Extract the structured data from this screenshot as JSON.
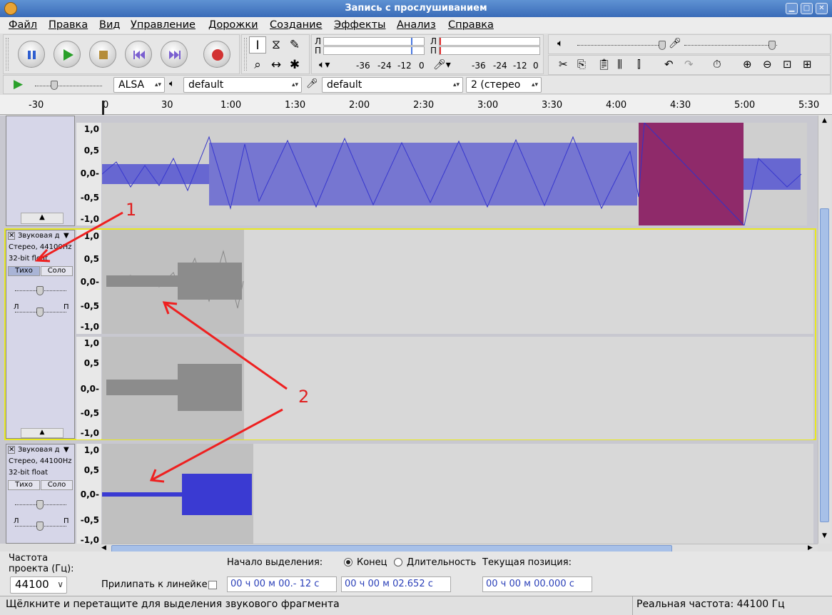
{
  "window": {
    "title": "Запись с прослушиванием"
  },
  "menu": [
    "Файл",
    "Правка",
    "Вид",
    "Управление",
    "Дорожки",
    "Создание",
    "Эффекты",
    "Анализ",
    "Справка"
  ],
  "meters": {
    "left_label": "Л",
    "right_label": "П",
    "scale": [
      "-36",
      "-24",
      "-12",
      "0"
    ]
  },
  "device": {
    "host": "ALSA",
    "playback": "default",
    "recording": "default",
    "channels": "2 (стерео"
  },
  "ruler": {
    "ticks": [
      "-30",
      "0",
      "30",
      "1:00",
      "1:30",
      "2:00",
      "2:30",
      "3:00",
      "3:30",
      "4:00",
      "4:30",
      "5:00",
      "5:30"
    ]
  },
  "scale_labels": [
    "1,0",
    "0,5",
    "0,0-",
    "-0,5",
    "-1,0"
  ],
  "tracks": [
    {
      "name": "Звуковая д",
      "info1": "Стерео, 44100Hz",
      "info2": "32-bit float",
      "mute": "Тихо",
      "solo": "Соло",
      "gain_l": "Л",
      "gain_r": "П"
    },
    {
      "name": "Звуковая д",
      "info1": "Стерео, 44100Hz",
      "info2": "32-bit float",
      "mute": "Тихо",
      "solo": "Соло",
      "gain_l": "Л",
      "gain_r": "П"
    }
  ],
  "annotations": {
    "label1": "1",
    "label2": "2"
  },
  "selection": {
    "rate_label": "Частота проекта (Гц):",
    "rate_value": "44100",
    "snap_label": "Прилипать к линейке",
    "start_label": "Начало выделения:",
    "end_label": "Конец",
    "length_label": "Длительность",
    "pos_label": "Текущая позиция:",
    "start_value": "00 ч 00 м 00.- 12 с",
    "end_value": "00 ч 00 м 02.652 с",
    "pos_value": "00 ч 00 м 00.000 с"
  },
  "status": {
    "hint": "Щёлкните и перетащите для выделения звукового фрагмента",
    "rate": "Реальная частота: 44100 Гц"
  }
}
